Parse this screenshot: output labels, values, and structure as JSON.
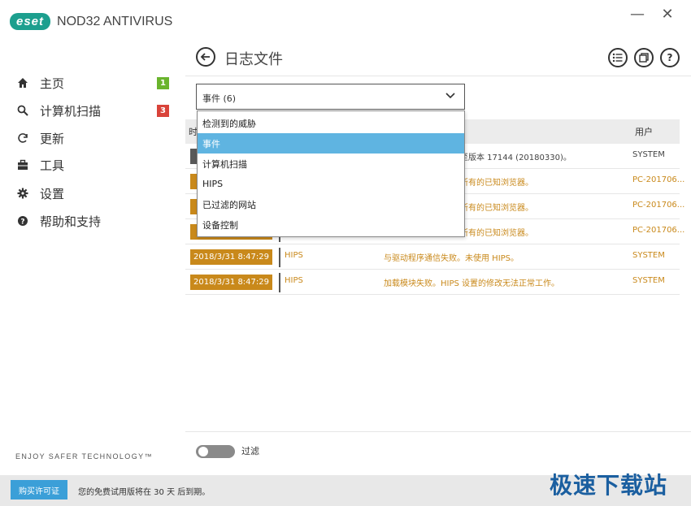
{
  "app": {
    "logo_text": "eset",
    "product_name": "NOD32 ANTIVIRUS",
    "tagline": "ENJOY SAFER TECHNOLOGY™",
    "accent_color": "#1c9f8e"
  },
  "window": {
    "minimize": "—",
    "close": "✕"
  },
  "sidebar": {
    "items": [
      {
        "label": "主页",
        "icon": "home-icon",
        "badge": "1",
        "badge_color": "#6ab42d"
      },
      {
        "label": "计算机扫描",
        "icon": "search-icon",
        "badge": "3",
        "badge_color": "#d9433a"
      },
      {
        "label": "更新",
        "icon": "refresh-icon"
      },
      {
        "label": "工具",
        "icon": "toolbox-icon"
      },
      {
        "label": "设置",
        "icon": "gear-icon"
      },
      {
        "label": "帮助和支持",
        "icon": "help-icon"
      }
    ]
  },
  "header": {
    "title": "日志文件",
    "icons": [
      "list-icon",
      "copy-icon",
      "help-icon"
    ]
  },
  "dropdown": {
    "selected": "事件 (6)",
    "options": [
      "检测到的威胁",
      "事件",
      "计算机扫描",
      "HIPS",
      "已过滤的网站",
      "设备控制"
    ],
    "highlighted_index": 1
  },
  "table": {
    "headers": {
      "time": "时",
      "user": "用户"
    },
    "rows": [
      {
        "time": "",
        "module": "",
        "event": "至版本 17144 (20180330)。",
        "user": "SYSTEM",
        "style": "normal"
      },
      {
        "time": "",
        "module": "",
        "event": "所有的已知浏览器。",
        "user": "PC-201706...",
        "style": "warn"
      },
      {
        "time": "",
        "module": "",
        "event": "所有的已知浏览器。",
        "user": "PC-201706...",
        "style": "warn"
      },
      {
        "time": "",
        "module": "",
        "event": "所有的已知浏览器。",
        "user": "PC-201706...",
        "style": "warn"
      },
      {
        "time": "2018/3/31 8:47:29",
        "module": "HIPS",
        "event": "与驱动程序通信失败。未使用 HIPS。",
        "user": "SYSTEM",
        "style": "warn"
      },
      {
        "time": "2018/3/31 8:47:29",
        "module": "HIPS",
        "event": "加载模块失败。HIPS 设置的修改无法正常工作。",
        "user": "SYSTEM",
        "style": "warn"
      }
    ]
  },
  "filter": {
    "label": "过滤",
    "enabled": false
  },
  "status": {
    "buy_label": "购买许可证",
    "message": "您的免费试用版将在 30 天 后到期。"
  },
  "watermark": "极速下载站"
}
